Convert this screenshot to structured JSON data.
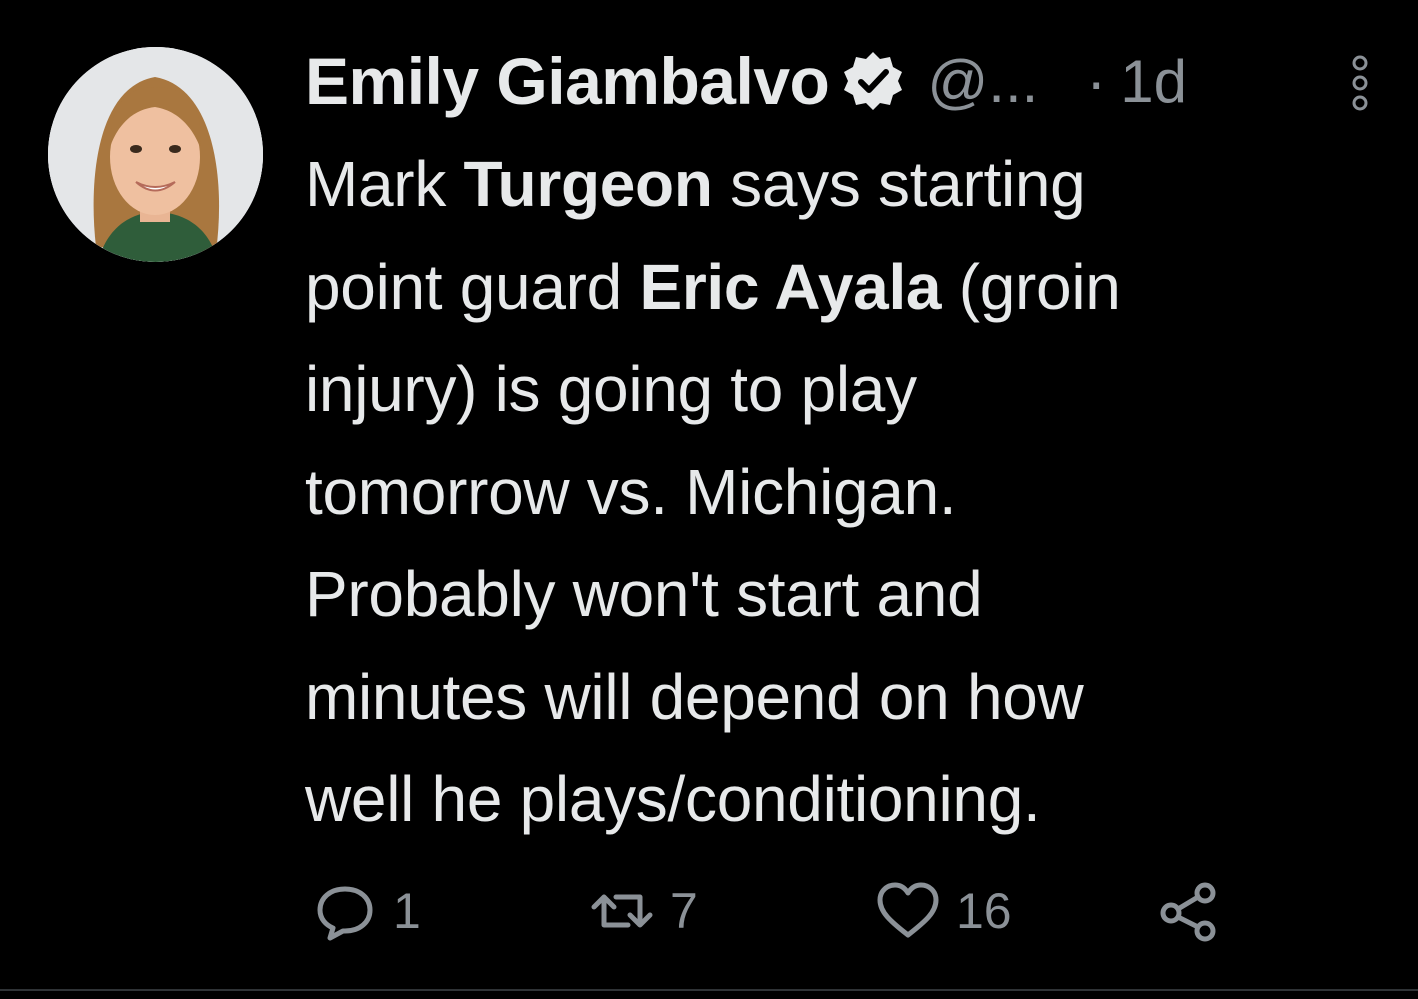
{
  "tweet": {
    "author": {
      "name": "Emily Giambalvo",
      "handle": "@...",
      "verified": true
    },
    "separator": "·",
    "time": "1d",
    "body": {
      "line1_a": "Mark ",
      "line1_b": "Turgeon",
      "line1_c": " says starting",
      "line2_a": "point guard ",
      "line2_b": "Eric Ayala",
      "line2_c": " (groin",
      "line3": "injury) is going to play",
      "line4": "tomorrow vs. Michigan.",
      "line5": "Probably won't start and",
      "line6": "minutes will depend on how",
      "line7": "well he plays/conditioning."
    },
    "actions": {
      "replies": "1",
      "retweets": "7",
      "likes": "16"
    }
  },
  "icons": {
    "avatar": "profile-photo",
    "verified": "verified-badge-icon",
    "more": "vertical-dots-icon",
    "reply": "reply-bubble-icon",
    "retweet": "retweet-icon",
    "like": "heart-icon",
    "share": "share-icon"
  },
  "colors": {
    "background": "#000000",
    "text": "#e7e9ea",
    "muted": "#8b9197"
  }
}
